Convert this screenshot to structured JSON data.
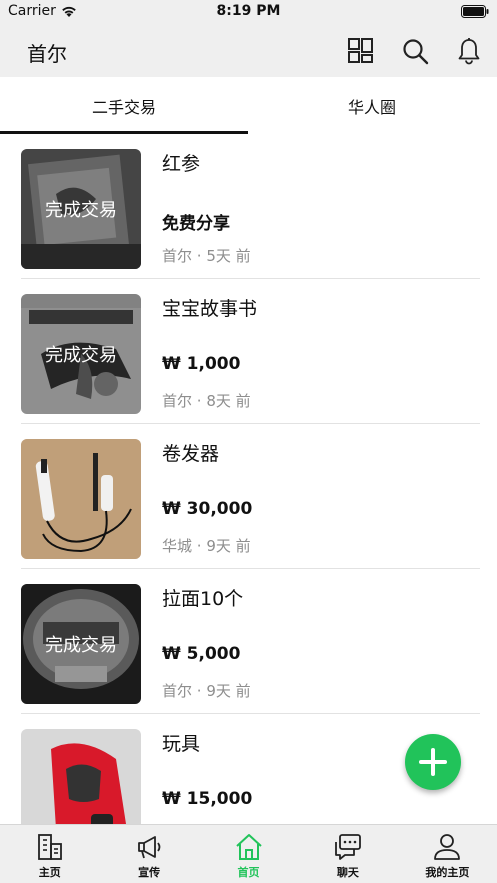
{
  "status": {
    "carrier": "Carrier",
    "time": "8:19 PM"
  },
  "header": {
    "title": "首尔"
  },
  "tabs": [
    {
      "label": "二手交易"
    },
    {
      "label": "华人圈"
    }
  ],
  "items": [
    {
      "title": "红参",
      "price": "免费分享",
      "location": "首尔",
      "time": "5天 前",
      "sold_label": "完成交易"
    },
    {
      "title": "宝宝故事书",
      "price": "₩ 1,000",
      "location": "首尔",
      "time": "8天 前",
      "sold_label": "完成交易"
    },
    {
      "title": "卷发器",
      "price": "₩ 30,000",
      "location": "华城",
      "time": "9天 前",
      "sold_label": ""
    },
    {
      "title": "拉面10个",
      "price": "₩ 5,000",
      "location": "首尔",
      "time": "9天 前",
      "sold_label": "完成交易"
    },
    {
      "title": "玩具",
      "price": "₩ 15,000",
      "location": "",
      "time": "",
      "sold_label": ""
    }
  ],
  "meta_separator": " · ",
  "tabbar": [
    {
      "label": "主页",
      "icon": "building-icon"
    },
    {
      "label": "宣传",
      "icon": "megaphone-icon"
    },
    {
      "label": "首页",
      "icon": "home-icon",
      "active": true
    },
    {
      "label": "聊天",
      "icon": "chat-icon"
    },
    {
      "label": "我的主页",
      "icon": "person-icon"
    }
  ],
  "colors": {
    "accent": "#21c35a",
    "bar_bg": "#efefef",
    "meta_text": "#8e8e8e"
  }
}
